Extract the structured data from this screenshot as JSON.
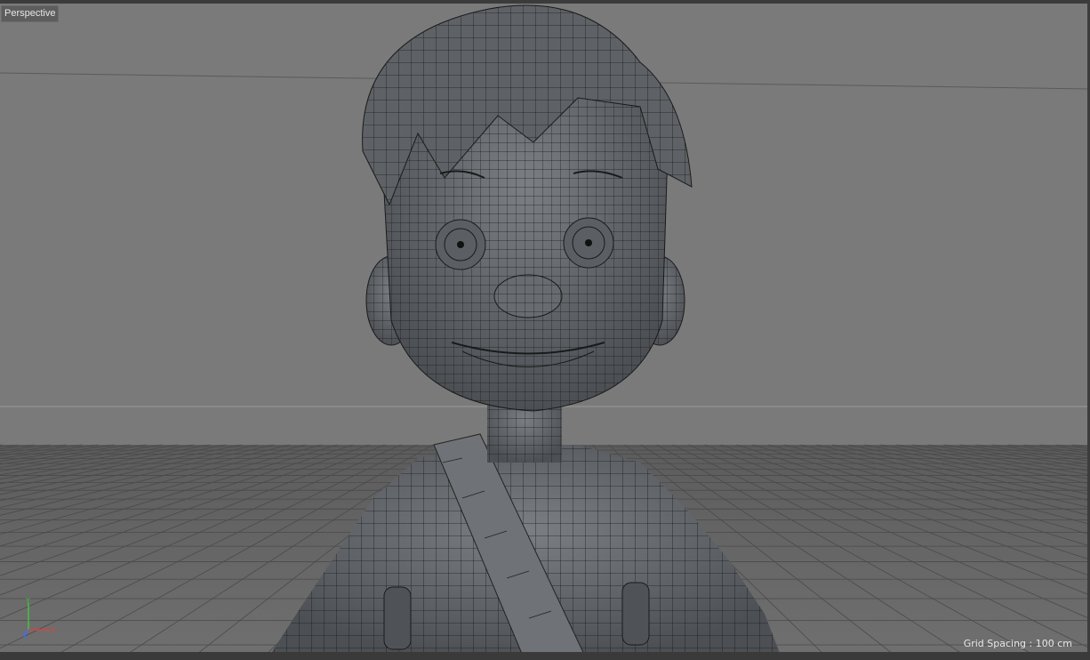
{
  "viewport": {
    "camera_label": "Perspective",
    "grid_spacing_text": "Grid Spacing : 100 cm"
  },
  "axis_gizmo": {
    "y_label": "Y",
    "x_label": "X",
    "z_label": "Z",
    "colors": {
      "y": "#3ec43e",
      "x": "#e0403a",
      "z": "#4a6de0"
    }
  },
  "scene": {
    "description_icons": [
      "wireframe-character-model"
    ],
    "colors": {
      "background": "#7c7c7c",
      "floor": "#6f6f6f",
      "mesh": "#5b5f63",
      "wire": "#111111"
    }
  }
}
